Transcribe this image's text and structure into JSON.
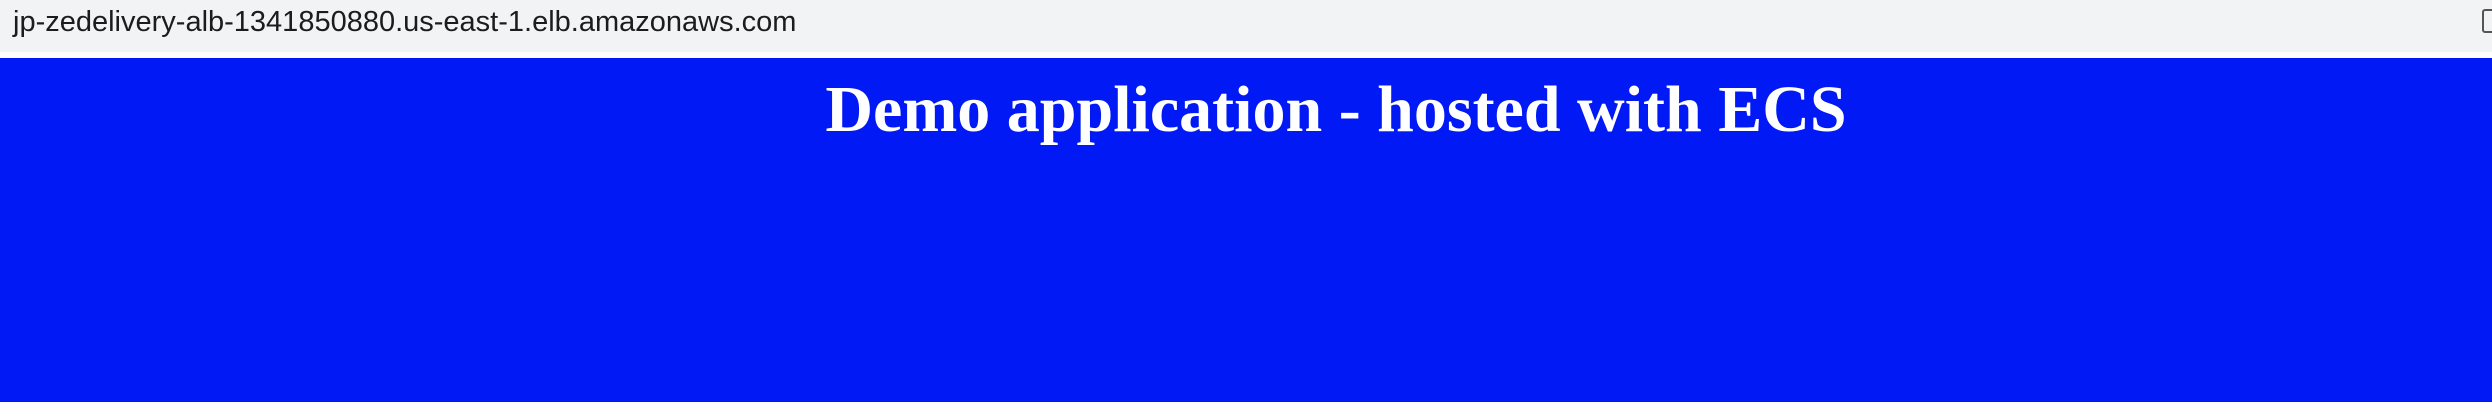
{
  "browser": {
    "url": "jp-zedelivery-alb-1341850880.us-east-1.elb.amazonaws.com",
    "icons": [
      "share-icon"
    ]
  },
  "page": {
    "title": "Demo application - hosted with ECS",
    "background_color": "#0019f5",
    "title_color": "#ffffff"
  }
}
